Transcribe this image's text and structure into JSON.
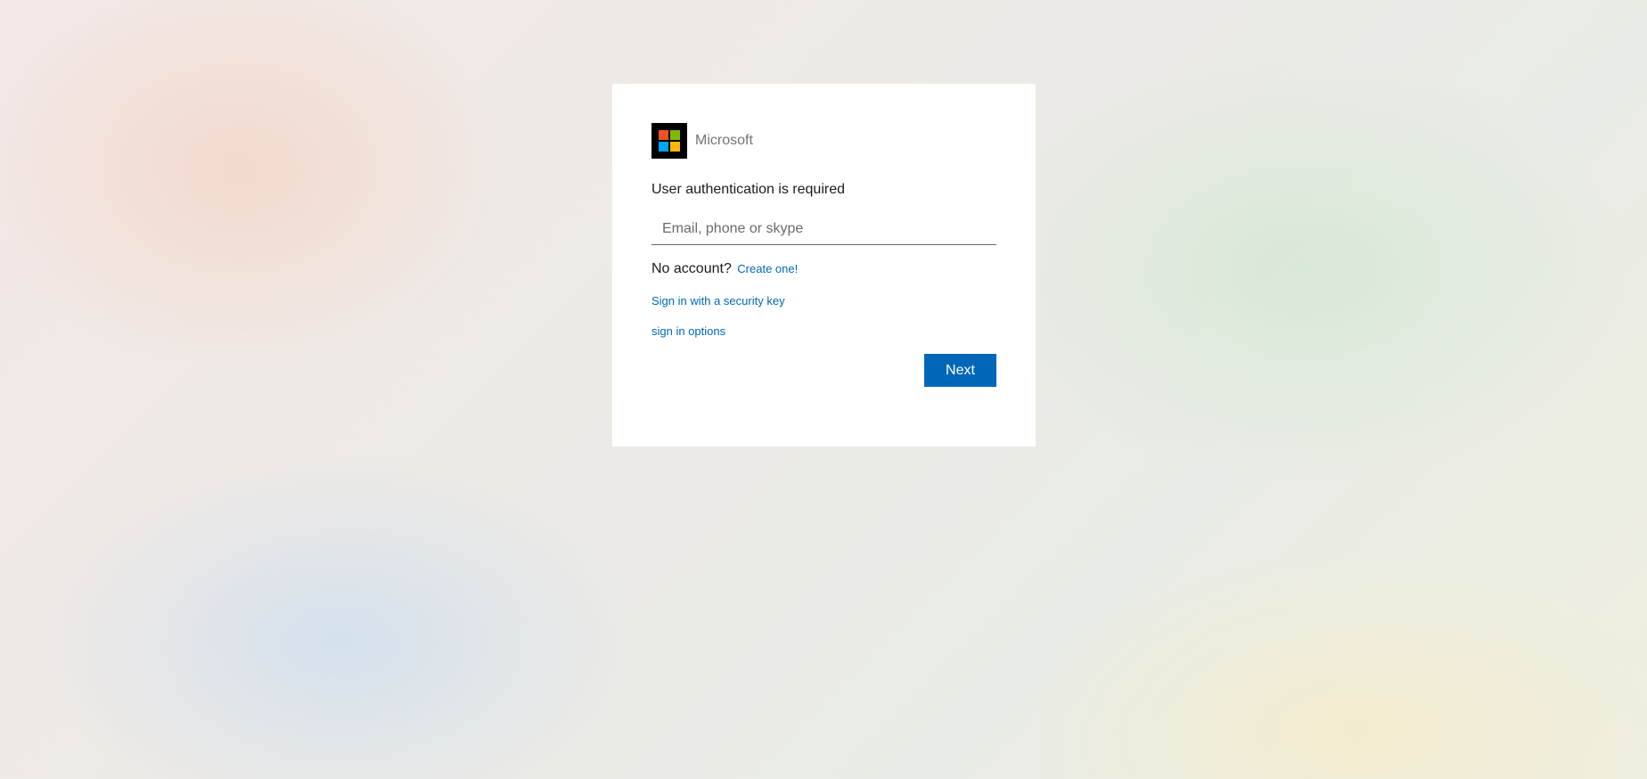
{
  "brand": {
    "name": "Microsoft",
    "logo_icon": "microsoft-logo-icon",
    "logo_colors": [
      "#f25022",
      "#7fba00",
      "#00a4ef",
      "#ffb900"
    ]
  },
  "form": {
    "heading": "User authentication is required",
    "email_placeholder": "Email, phone or skype",
    "email_value": "",
    "no_account_text": "No account?",
    "create_link": "Create one!",
    "security_key_link": "Sign in with a security key",
    "sign_in_options_link": "sign in options",
    "next_label": "Next"
  },
  "colors": {
    "accent": "#0067b8",
    "link": "#0067b8",
    "text": "#1b1b1b",
    "muted": "#737373"
  }
}
